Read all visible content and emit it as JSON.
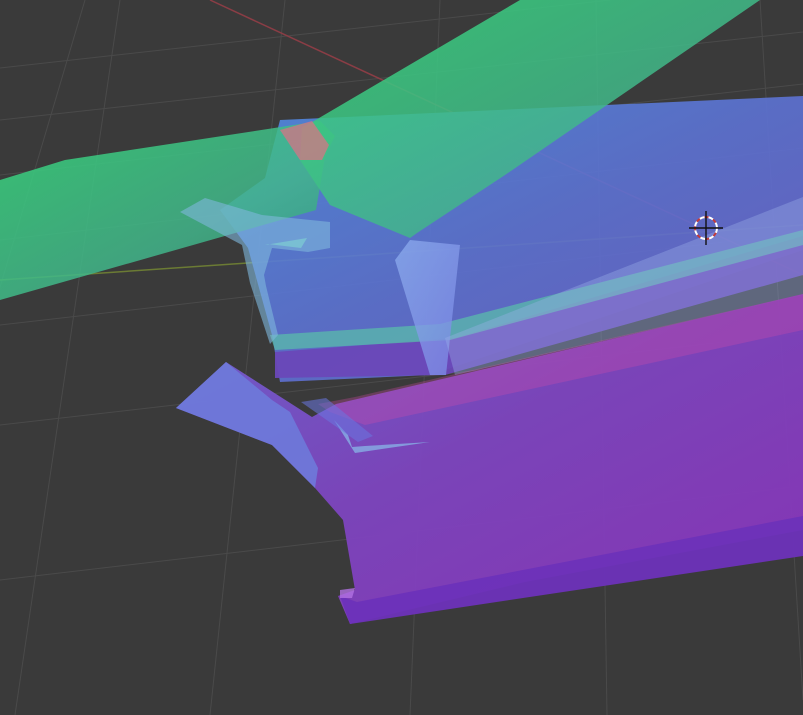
{
  "app": {
    "name": "3D viewport",
    "view": "perspective"
  },
  "viewport": {
    "background_color": "#3a3a3a",
    "grid_color": "#4a4a4a",
    "x_axis_color": "#8a3d45",
    "y_axis_color": "#6b7b34"
  },
  "scene": {
    "objects": [
      {
        "name": "upper-green-panel",
        "color": "#3ecf77"
      },
      {
        "name": "upper-blue-panel",
        "color": "#4f7ad8"
      },
      {
        "name": "lower-purple-panel",
        "color": "#8b4fc9"
      }
    ]
  },
  "cursor": {
    "icon": "3d-cursor-icon",
    "ring_colors": [
      "#ffffff",
      "#c43b3b"
    ]
  }
}
